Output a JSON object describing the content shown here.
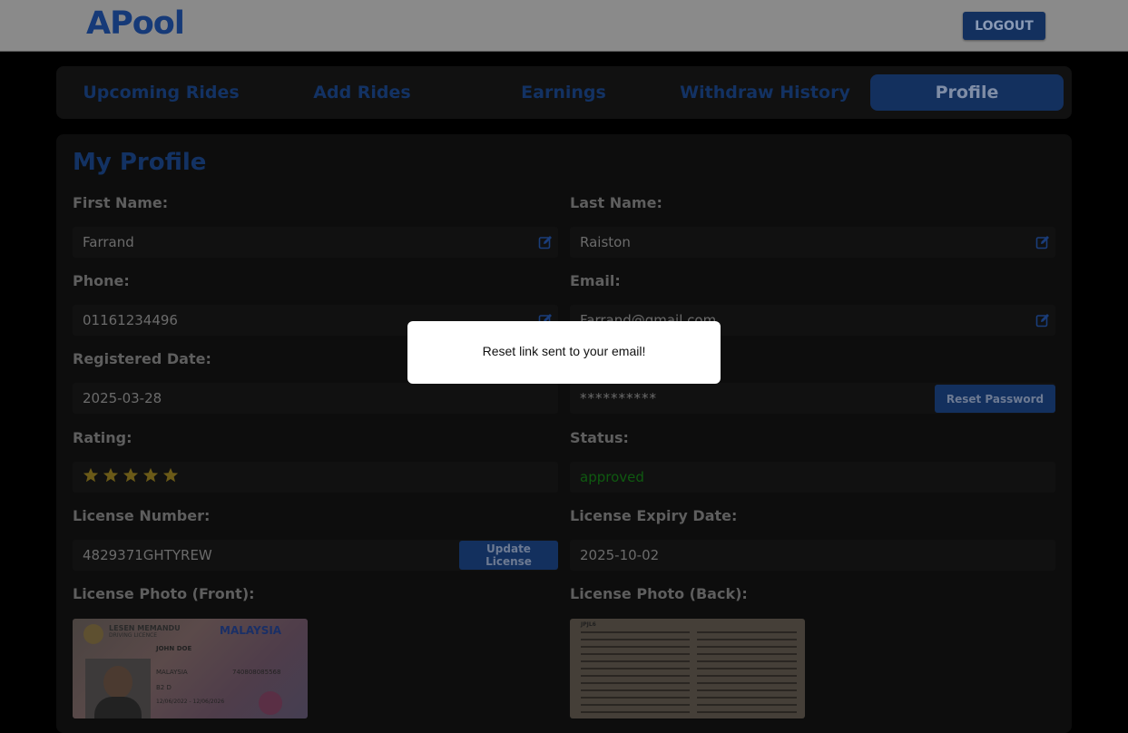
{
  "app": {
    "logo": "APool"
  },
  "header": {
    "logout_label": "LOGOUT"
  },
  "tabs": [
    {
      "label": "Upcoming Rides",
      "active": false
    },
    {
      "label": "Add Rides",
      "active": false
    },
    {
      "label": "Earnings",
      "active": false
    },
    {
      "label": "Withdraw History",
      "active": false
    },
    {
      "label": "Profile",
      "active": true
    }
  ],
  "profile": {
    "title": "My Profile",
    "first_name": {
      "label": "First Name:",
      "value": "Farrand"
    },
    "last_name": {
      "label": "Last Name:",
      "value": "Raiston"
    },
    "phone": {
      "label": "Phone:",
      "value": "01161234496"
    },
    "email": {
      "label": "Email:",
      "value": "Farrand@gmail.com"
    },
    "registered_date": {
      "label": "Registered Date:",
      "value": "2025-03-28"
    },
    "password": {
      "value": "**********",
      "button": "Reset Password"
    },
    "rating": {
      "label": "Rating:",
      "stars": 5
    },
    "status": {
      "label": "Status:",
      "value": "approved",
      "color": "#0f5a10"
    },
    "license_number": {
      "label": "License Number:",
      "value": "4829371GHTYREW",
      "button": "Update License"
    },
    "license_expiry": {
      "label": "License Expiry Date:",
      "value": "2025-10-02"
    },
    "photo_front": {
      "label": "License Photo (Front):",
      "header_left": "LESEN MEMANDU",
      "header_sub": "DRIVING LICENCE",
      "country": "MALAYSIA",
      "name": "JOHN DOE",
      "nationality": "MALAYSIA",
      "id_number": "740808085568",
      "class": "B2 D",
      "validity": "12/06/2022 - 12/06/2026"
    },
    "photo_back": {
      "label": "License Photo (Back):",
      "header_left": "JPJL6"
    }
  },
  "modal": {
    "message": "Reset link sent to your email!"
  },
  "colors": {
    "accent": "#1f4fa8",
    "star": "#c9a227",
    "status_ok": "#1a8a1a"
  }
}
